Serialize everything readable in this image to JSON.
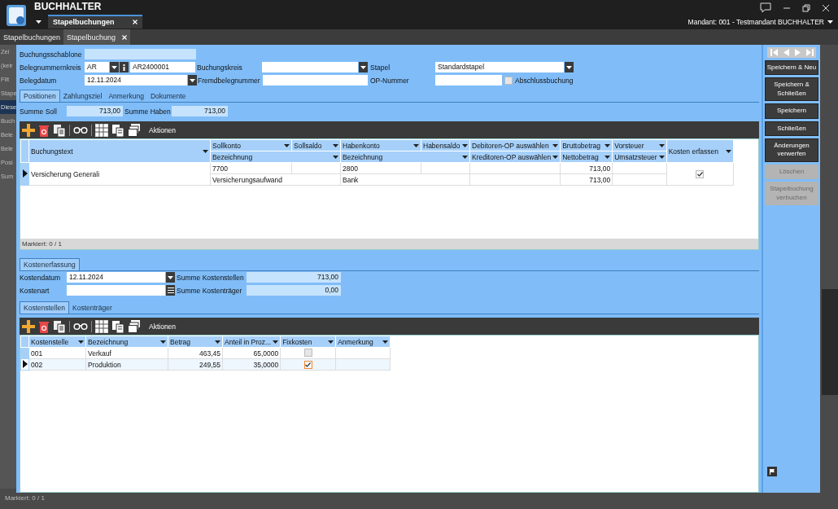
{
  "app": {
    "title": "BUCHHALTER",
    "tabs": [
      {
        "label": "Stapelbuchungen",
        "selected": true
      }
    ],
    "mandant": "Mandant: 001 - Testmandant BUCHHALTER"
  },
  "doc_tabs": [
    {
      "label": "Stapelbuchungen",
      "selected": false,
      "closable": false
    },
    {
      "label": "Stapelbuchung",
      "selected": true,
      "closable": true
    }
  ],
  "background": {
    "fragments": [
      "Zei",
      "(keir",
      "Filt",
      "Stape",
      "Diese",
      "Buch",
      "Bele",
      "Bele",
      "Posi",
      "Sum"
    ],
    "status": "Markiert: 0 / 1"
  },
  "form": {
    "buchungsschablone": {
      "label": "Buchungsschablone"
    },
    "belegnummernkreis": {
      "label": "Belegnummernkreis",
      "value": "AR",
      "number": "AR2400001"
    },
    "buchungskreis": {
      "label": "Buchungskreis"
    },
    "stapel": {
      "label": "Stapel",
      "value": "Standardstapel"
    },
    "belegdatum": {
      "label": "Belegdatum",
      "value": "12.11.2024"
    },
    "fremdbelegnummer": {
      "label": "Fremdbelegnummer"
    },
    "op_nummer": {
      "label": "OP-Nummer"
    },
    "abschlussbuchung": {
      "label": "Abschlussbuchung",
      "checked": false
    }
  },
  "tabs": [
    {
      "label": "Positionen",
      "selected": true
    },
    {
      "label": "Zahlungsziel",
      "selected": false
    },
    {
      "label": "Anmerkung",
      "selected": false
    },
    {
      "label": "Dokumente",
      "selected": false
    }
  ],
  "sums": [
    {
      "label": "Summe Soll",
      "value": "713,00"
    },
    {
      "label": "Summe Haben",
      "value": "713,00"
    }
  ],
  "toolbar": {
    "label": "Aktionen"
  },
  "table": {
    "header": {
      "buchungstext": "Buchungstext",
      "sollkonto": "Sollkonto",
      "sollsaldo": "Sollsaldo",
      "soll_bezeichnung": "Bezeichnung",
      "habenkonto": "Habenkonto",
      "habensaldo": "Habensaldo",
      "haben_bezeichnung": "Bezeichnung",
      "debitoren": "Debitoren-OP auswählen",
      "kreditoren": "Kreditoren-OP auswählen",
      "brutto": "Bruttobetrag",
      "netto": "Nettobetrag",
      "vorsteuer": "Vorsteuer",
      "umsatzsteuer": "Umsatzsteuer",
      "kosten": "Kosten erfassen"
    },
    "rows": [
      {
        "current": true,
        "buchungstext": "Versicherung Generali",
        "sollkonto": "7700",
        "habenkonto": "2800",
        "brutto": "713,00",
        "soll_bezeichnung": "Versicherungsaufwand",
        "haben_bezeichnung": "Bank",
        "netto": "713,00",
        "kosten_erfassen": true
      }
    ],
    "footer": "Markiert: 0 / 1"
  },
  "cost": {
    "tab": {
      "label": "Kostenerfassung",
      "selected": true
    },
    "kostendatum": {
      "label": "Kostendatum",
      "value": "12.11.2024"
    },
    "kostenart": {
      "label": "Kostenart"
    },
    "sums": [
      {
        "label": "Summe Kostenstellen",
        "value": "713,00"
      },
      {
        "label": "Summe Kostenträger",
        "value": "0,00"
      }
    ],
    "tabs": [
      {
        "label": "Kostenstellen",
        "selected": true
      },
      {
        "label": "Kostenträger",
        "selected": false
      }
    ],
    "toolbar": {
      "label": "Aktionen"
    },
    "columns": [
      "Kostenstelle",
      "Bezeichnung",
      "Betrag",
      "Anteil in Proz...",
      "Fixkosten",
      "Anmerkung"
    ],
    "rows": [
      {
        "kostenstelle": "001",
        "bezeichnung": "Verkauf",
        "betrag": "463,45",
        "anteil": "65,0000",
        "fixkosten": false,
        "current": false
      },
      {
        "kostenstelle": "002",
        "bezeichnung": "Produktion",
        "betrag": "249,55",
        "anteil": "35,0000",
        "fixkosten": true,
        "current": true
      }
    ]
  },
  "actions": [
    {
      "label": "Speichern & Neu",
      "disabled": false
    },
    {
      "label": "Speichern & Schließen",
      "disabled": false
    },
    {
      "label": "Speichern",
      "disabled": false
    },
    {
      "label": "Schließen",
      "disabled": false
    },
    {
      "label": "Änderungen verwerfen",
      "disabled": false
    },
    {
      "label": "Löschen",
      "disabled": true
    },
    {
      "label": "Stapelbuchung verbuchen",
      "disabled": true
    }
  ]
}
